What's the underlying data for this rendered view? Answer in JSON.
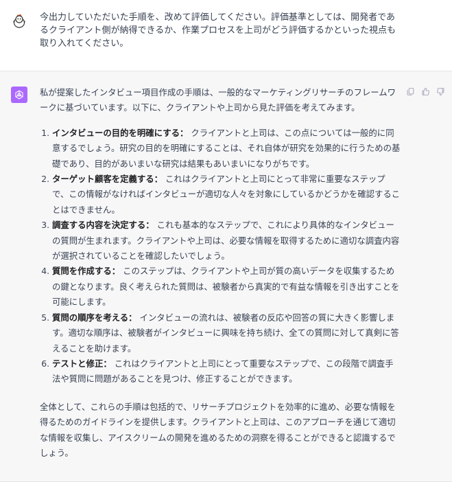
{
  "user_message": {
    "text": "今出力していただいた手順を、改めて評価してください。評価基準としては、開発者であるクライアント側が納得できるか、作業プロセスを上司がどう評価するかといった視点も取り入れてください。"
  },
  "assistant_message": {
    "intro": "私が提案したインタビュー項目作成の手順は、一般的なマーケティングリサーチのフレームワークに基づいています。以下に、クライアントや上司から見た評価を考えてみます。",
    "items": [
      {
        "title": "インタビューの目的を明確にする：",
        "body": "クライアントと上司は、この点については一般的に同意するでしょう。研究の目的を明確にすることは、それ自体が研究を効果的に行うための基礎であり、目的があいまいな研究は結果もあいまいになりがちです。"
      },
      {
        "title": "ターゲット顧客を定義する：",
        "body": "これはクライアントと上司にとって非常に重要なステップで、この情報がなければインタビューが適切な人々を対象にしているかどうかを確認することはできません。"
      },
      {
        "title": "調査する内容を決定する：",
        "body": "これも基本的なステップで、これにより具体的なインタビューの質問が生まれます。クライアントや上司は、必要な情報を取得するために適切な調査内容が選択されていることを確認したいでしょう。"
      },
      {
        "title": "質問を作成する：",
        "body": "このステップは、クライアントや上司が質の高いデータを収集するための鍵となります。良く考えられた質問は、被験者から真実的で有益な情報を引き出すことを可能にします。"
      },
      {
        "title": "質問の順序を考える：",
        "body": "インタビューの流れは、被験者の反応や回答の質に大きく影響します。適切な順序は、被験者がインタビューに興味を持ち続け、全ての質問に対して真剣に答えることを助けます。"
      },
      {
        "title": "テストと修正：",
        "body": "これはクライアントと上司にとって重要なステップで、この段階で調査手法や質問に問題があることを見つけ、修正することができます。"
      }
    ],
    "summary": "全体として、これらの手順は包括的で、リサーチプロジェクトを効率的に進め、必要な情報を得るためのガイドラインを提供します。クライアントと上司は、このアプローチを通じて適切な情報を収集し、アイスクリームの開発を進めるための洞察を得ることができると認識するでしょう。"
  },
  "icons": {
    "user_avatar": "chick-avatar-icon",
    "assistant_avatar": "openai-logo-icon",
    "copy": "copy-icon",
    "thumbs_up": "thumbs-up-icon",
    "thumbs_down": "thumbs-down-icon"
  },
  "colors": {
    "assistant_avatar_bg": "#ab68ff",
    "assistant_row_bg": "#f7f7f8",
    "action_icon": "#acacbe"
  }
}
